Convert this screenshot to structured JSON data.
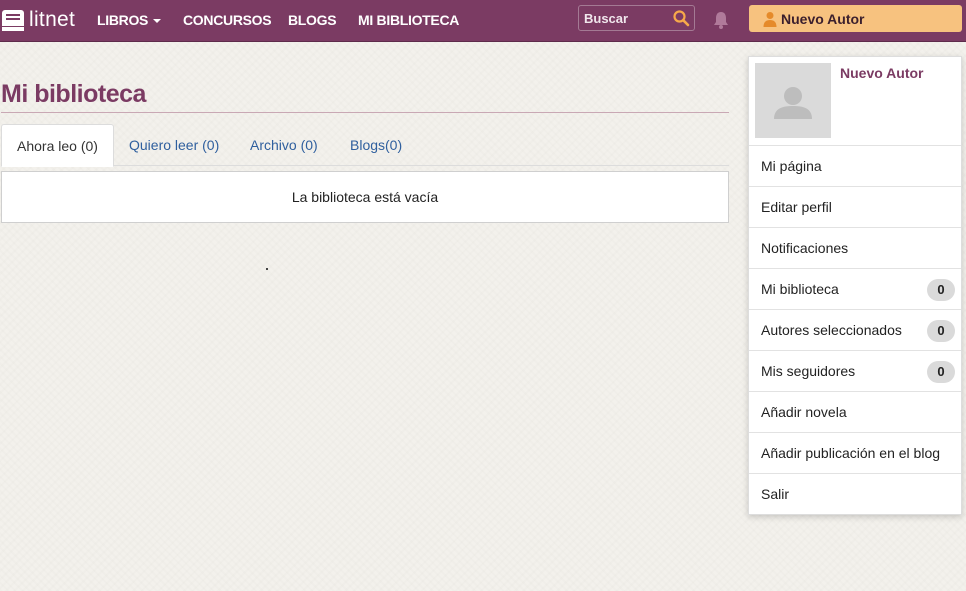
{
  "brand": {
    "name": "litnet"
  },
  "nav": {
    "books": "LIBROS",
    "contests": "CONCURSOS",
    "blogs": "BLOGS",
    "library": "MI BIBLIOTECA"
  },
  "search": {
    "placeholder": "Buscar"
  },
  "user": {
    "name": "Nuevo Autor"
  },
  "page": {
    "title": "Mi biblioteca",
    "tabs": [
      {
        "label": "Ahora leo (0)"
      },
      {
        "label": "Quiero leer (0)"
      },
      {
        "label": "Archivo (0)"
      },
      {
        "label": "Blogs(0)"
      }
    ],
    "empty_message": "La biblioteca está vacía"
  },
  "dropdown": {
    "name": "Nuevo Autor",
    "items": [
      {
        "label": "Mi página"
      },
      {
        "label": "Editar perfil"
      },
      {
        "label": "Notificaciones"
      },
      {
        "label": "Mi biblioteca",
        "badge": "0"
      },
      {
        "label": "Autores seleccionados",
        "badge": "0"
      },
      {
        "label": "Mis seguidores",
        "badge": "0"
      },
      {
        "label": "Añadir novela"
      },
      {
        "label": "Añadir publicación en el blog"
      },
      {
        "label": "Salir"
      }
    ]
  },
  "colors": {
    "brand": "#7b3b63",
    "author_button": "#f7c27f",
    "link": "#2f5f9e",
    "search_icon": "#f7a94a"
  },
  "icons": {
    "logo": "book-stack-icon",
    "search": "search-icon",
    "notifications": "bell-icon",
    "user": "person-icon",
    "avatar": "default-avatar-icon"
  }
}
